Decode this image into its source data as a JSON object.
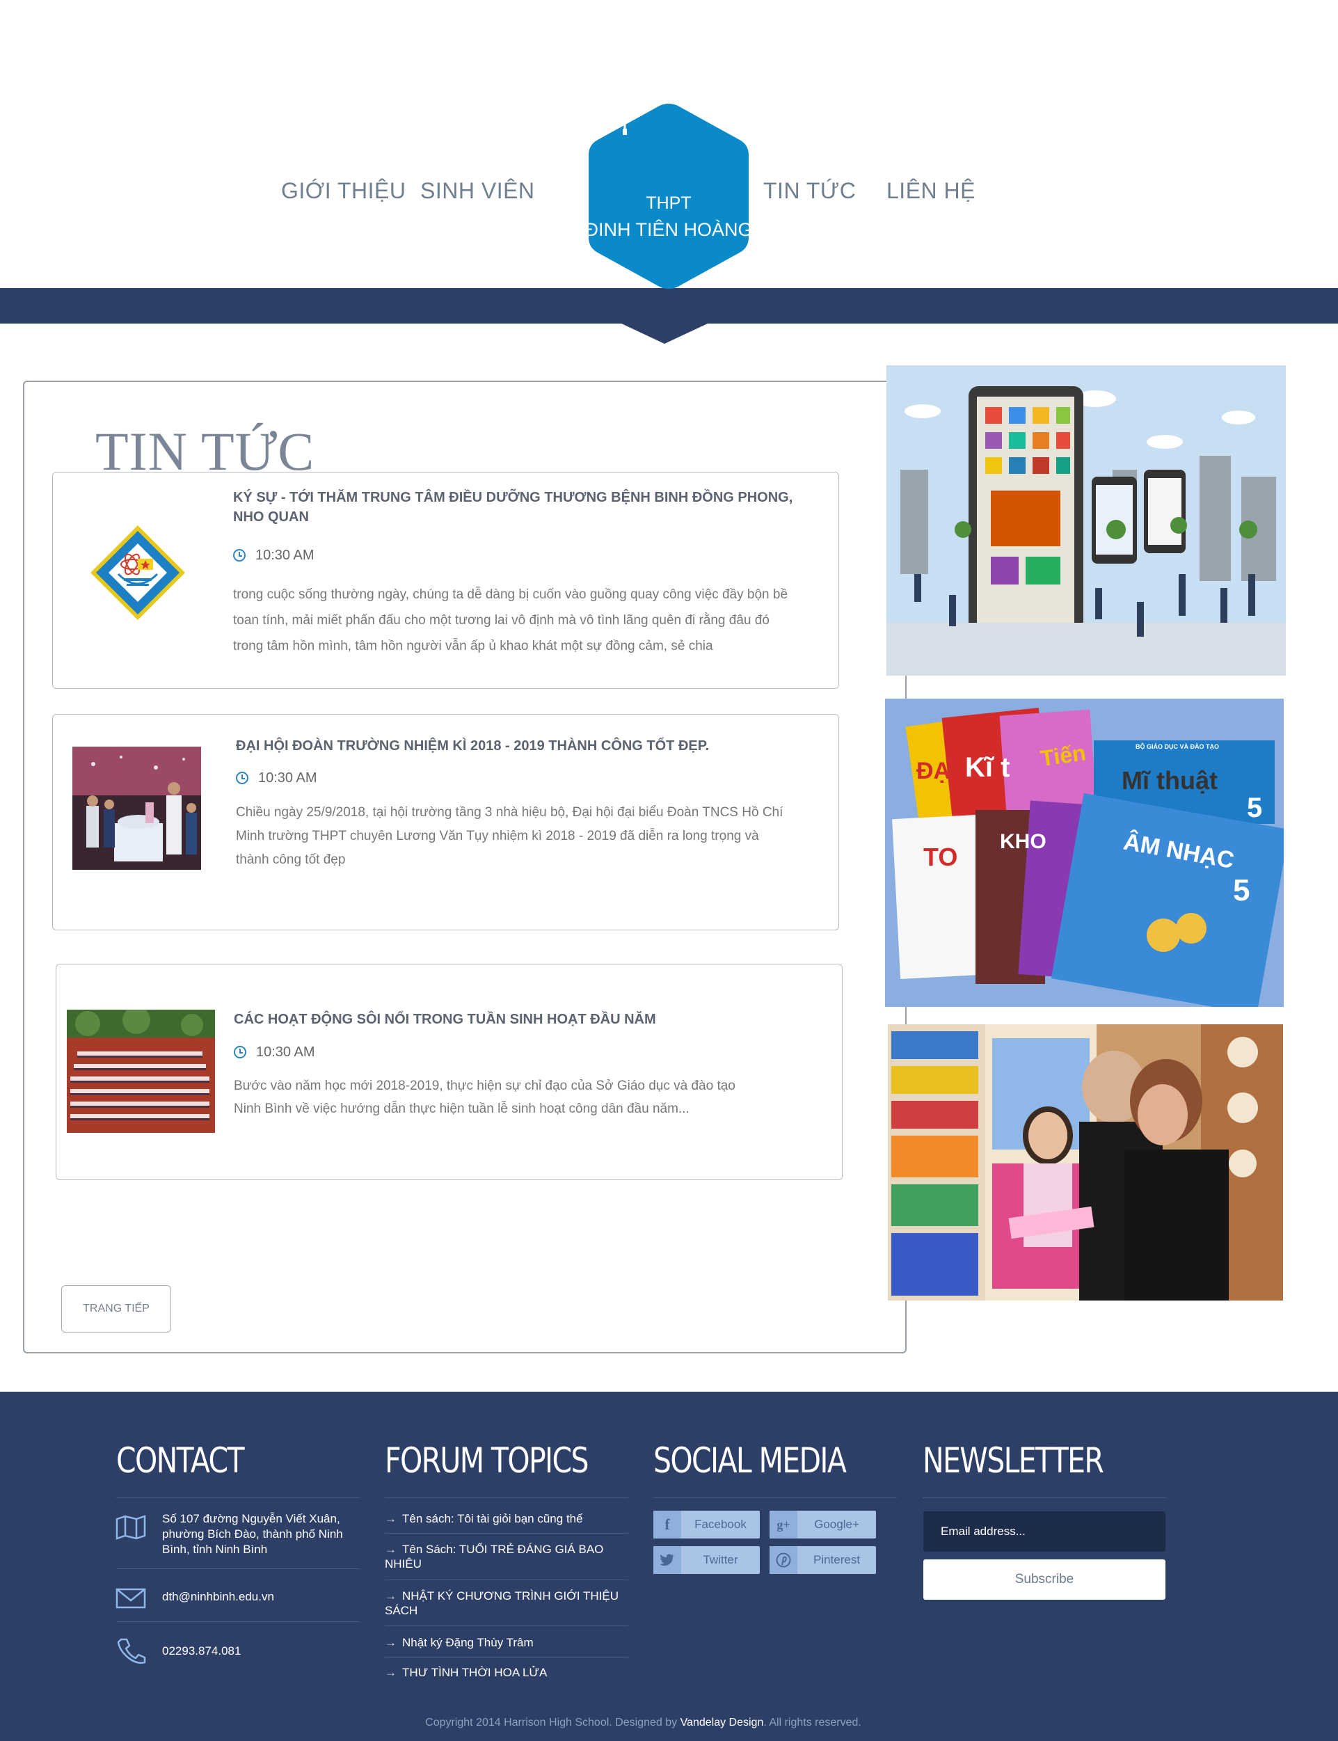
{
  "nav": {
    "items": [
      "GIỚI THIỆU",
      "SINH VIÊN",
      "TIN TỨC",
      "LIÊN HỆ"
    ]
  },
  "logo": {
    "line1": "THPT",
    "line2": "ĐINH TIÊN HOÀNG",
    "icon": "graduation-cap-icon",
    "color": "#0a8ac8"
  },
  "colors": {
    "navy": "#2d3f66",
    "accent": "#0a8ac8"
  },
  "news": {
    "heading": "TIN TỨC",
    "items": [
      {
        "title": "KÝ SỰ - TỚI THĂM TRUNG TÂM ĐIỀU DƯỠNG THƯƠNG BỆNH BINH ĐỒNG PHONG, NHO QUAN",
        "time": "10:30 AM",
        "excerpt": "trong cuộc sống thường ngày, chúng ta dễ dàng bị cuốn vào guồng quay công việc đầy bộn bề toan tính, mải miết phấn đấu cho một tương lai vô định mà vô tình lãng quên đi rằng đâu đó trong tâm hồn mình, tâm hồn người vẫn ấp ủ khao khát một sự đồng cảm, sẻ chia"
      },
      {
        "title": "ĐẠI HỘI ĐOÀN TRƯỜNG NHIỆM KÌ 2018 - 2019 THÀNH CÔNG TỐT ĐẸP.",
        "time": "10:30 AM",
        "excerpt": "Chiều ngày 25/9/2018, tại hội trường tầng 3 nhà hiệu bộ, Đại hội đại biểu Đoàn TNCS Hồ Chí Minh trường THPT chuyên Lương Văn Tụy nhiệm kì 2018 - 2019 đã diễn ra long trọng và thành công tốt đẹp"
      },
      {
        "title": "CÁC HOẠT ĐỘNG SÔI NỔI TRONG TUẦN SINH HOẠT ĐẦU NĂM",
        "time": "10:30 AM",
        "excerpt": "Bước vào năm học mới 2018-2019, thực hiện sự chỉ đạo của Sở Giáo dục và đào tạo Ninh Bình về việc hướng dẫn thực hiện tuần lễ sinh hoạt công dân đầu năm..."
      }
    ],
    "next_button": "TRANG TIẾP"
  },
  "side_images": {
    "books": [
      "ĐẠ",
      "Kĩ t",
      "Tiến",
      "Mĩ thuật",
      "5",
      "TO",
      "KHO",
      "ÂM NHẠC",
      "5",
      "BỘ GIÁO DỤC VÀ ĐÀO TẠO"
    ]
  },
  "footer": {
    "contact": {
      "heading": "CONTACT",
      "address": "Số 107 đường Nguyễn Viết Xuân, phường Bích Đào, thành phố Ninh Bình, tỉnh Ninh Bình",
      "email": "dth@ninhbinh.edu.vn",
      "phone": "02293.874.081"
    },
    "forum": {
      "heading": "FORUM TOPICS",
      "topics": [
        "Tên sách: Tôi tài giỏi bạn cũng thế",
        "Tên Sách: TUỔI TRẺ ĐÁNG GIÁ BAO NHIÊU",
        "NHẬT KÝ CHƯƠNG TRÌNH GIỚI THIỆU SÁCH",
        "Nhật ký Đặng Thùy Trâm",
        "THƯ TÌNH THỜI HOA LỬA"
      ]
    },
    "social": {
      "heading": "SOCIAL MEDIA",
      "facebook": "Facebook",
      "google": "Google+",
      "twitter": "Twitter",
      "pinterest": "Pinterest"
    },
    "newsletter": {
      "heading": "NEWSLETTER",
      "placeholder": "Email address...",
      "button": "Subscribe"
    },
    "copyright_prefix": "Copyright 2014 Harrison High School. Designed by ",
    "copyright_link": "Vandelay Design",
    "copyright_suffix": ". All rights reserved."
  }
}
